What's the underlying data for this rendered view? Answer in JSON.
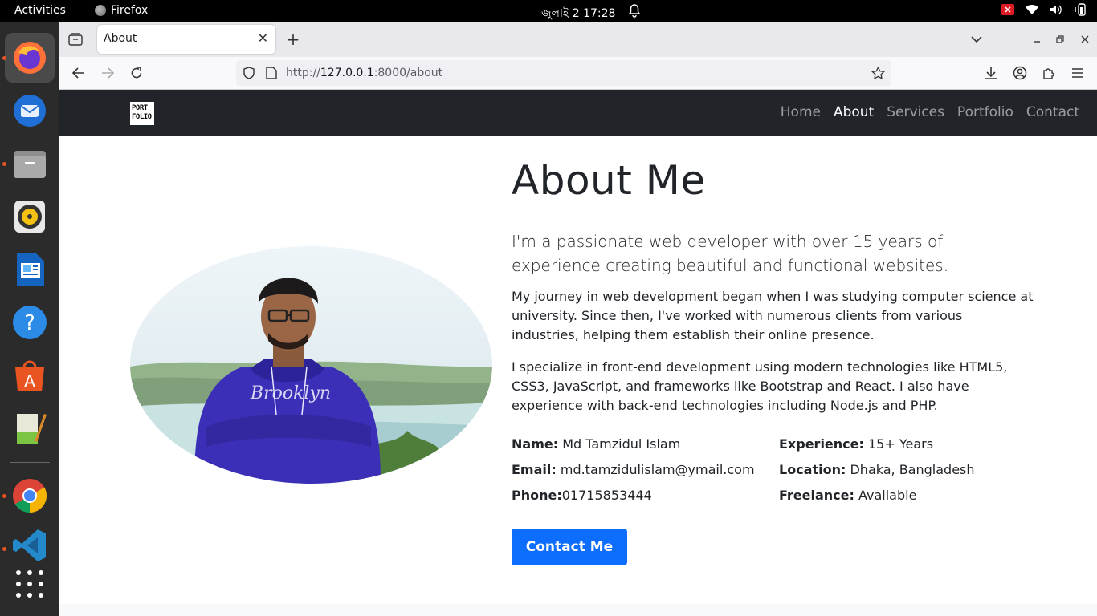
{
  "topbar": {
    "activities": "Activities",
    "app_name": "Firefox",
    "clock": "জুলাই 2  17:28"
  },
  "dock": {
    "items": [
      "firefox-icon",
      "thunderbird-icon",
      "files-icon",
      "rhythmbox-icon",
      "writer-icon",
      "help-icon",
      "app-center-icon",
      "text-editor-icon",
      "chrome-icon",
      "vscode-icon",
      "app-grid-icon"
    ]
  },
  "browser": {
    "tab_title": "About",
    "url_scheme": "http://",
    "url_host": "127.0.0.1",
    "url_path": ":8000/about"
  },
  "site": {
    "logo_line1": "PORT",
    "logo_line2": "FOLIO",
    "nav": [
      "Home",
      "About",
      "Services",
      "Portfolio",
      "Contact"
    ],
    "active_nav": "About"
  },
  "about": {
    "heading": "About Me",
    "lead": "I'm a passionate web developer with over 15 years of experience creating beautiful and functional websites.",
    "para1": "My journey in web development began when I was studying computer science at university. Since then, I've worked with numerous clients from various industries, helping them establish their online presence.",
    "para2": "I specialize in front-end development using modern technologies like HTML5, CSS3, JavaScript, and frameworks like Bootstrap and React. I also have experience with back-end technologies including Node.js and PHP.",
    "info": {
      "name_label": "Name:",
      "name_value": " Md Tamzidul Islam",
      "experience_label": "Experience:",
      "experience_value": " 15+ Years",
      "email_label": "Email:",
      "email_value": " md.tamzidulislam@ymail.com",
      "location_label": "Location:",
      "location_value": " Dhaka, Bangladesh",
      "phone_label": "Phone:",
      "phone_value": "01715853444",
      "freelance_label": "Freelance:",
      "freelance_value": " Available"
    },
    "button": "Contact Me",
    "photo_shirt_text": "Brooklyn"
  }
}
